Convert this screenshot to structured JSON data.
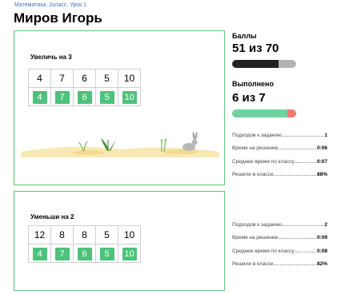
{
  "breadcrumb": "Математика. 2класс. Урок 1",
  "student_name": "Миров Игорь",
  "tasks": [
    {
      "title": "Увеличь на 3",
      "numbers": [
        "4",
        "7",
        "6",
        "5",
        "10"
      ],
      "answers": [
        "4",
        "7",
        "6",
        "5",
        "10"
      ],
      "stats": [
        {
          "label": "Подходов к заданию",
          "value": "1"
        },
        {
          "label": "Время на решение",
          "value": "0:06"
        },
        {
          "label": "Среднее время по классу",
          "value": "0:07"
        },
        {
          "label": "Решили в классе",
          "value": "88%"
        }
      ]
    },
    {
      "title": "Уменьши на 2",
      "numbers": [
        "12",
        "8",
        "8",
        "5",
        "10"
      ],
      "answers": [
        "4",
        "7",
        "6",
        "5",
        "10"
      ],
      "stats": [
        {
          "label": "Подходов к заданию",
          "value": "2"
        },
        {
          "label": "Время на решение",
          "value": "0:09"
        },
        {
          "label": "Среднее время по классу",
          "value": "0:08"
        },
        {
          "label": "Решили в классе",
          "value": "82%"
        }
      ]
    }
  ],
  "summary": {
    "score_label": "Баллы",
    "score_value": "51 из 70",
    "score_fraction": 0.729,
    "done_label": "Выполнено",
    "done_value": "6 из 7",
    "done_fraction": 0.857
  },
  "colors": {
    "accent_green": "#5fc777",
    "answer_green": "#4cc27a",
    "score_bar": "#222222",
    "score_track": "#b3b3b3",
    "done_bar": "#6fd3a0",
    "done_track": "#f07a6e",
    "breadcrumb_blue": "#3d72c8"
  }
}
